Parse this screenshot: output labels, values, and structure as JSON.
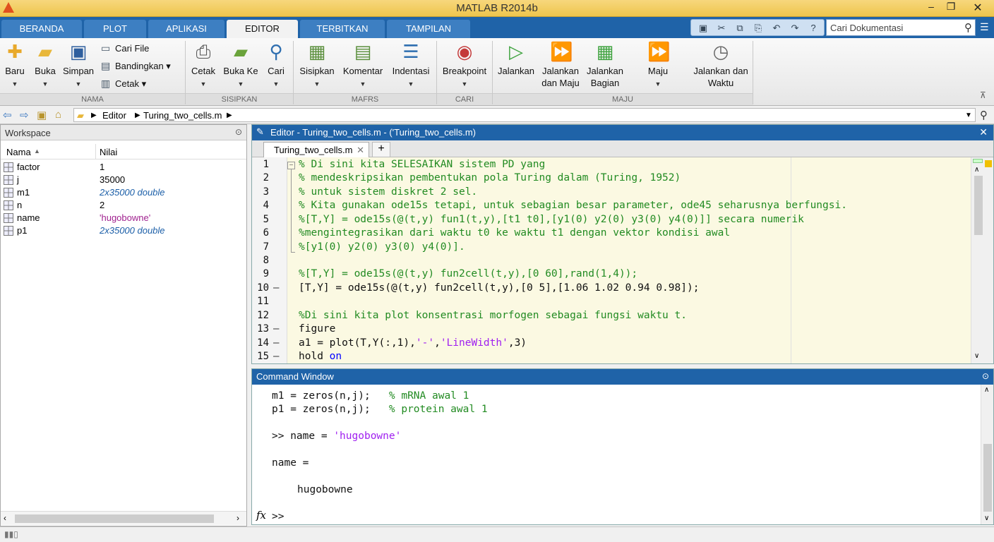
{
  "window": {
    "title": "MATLAB R2014b"
  },
  "tabs": [
    "BERANDA",
    "PLOT",
    "APLIKASI",
    "EDITOR",
    "TERBITKAN",
    "TAMPILAN"
  ],
  "search": {
    "placeholder": "Cari Dokumentasi"
  },
  "ribbon": {
    "file": {
      "new": "Baru",
      "open": "Buka",
      "save": "Simpan",
      "find_files": "Cari File",
      "compare": "Bandingkan",
      "print_small": "Cetak",
      "group": "NAMA"
    },
    "navigate": {
      "print": "Cetak",
      "goto": "Buka Ke",
      "find": "Cari",
      "group": "SISIPKAN"
    },
    "edit": {
      "insert": "Sisipkan",
      "comment": "Komentar",
      "indent": "Indentasi",
      "group": "MAFRS"
    },
    "breakpoints": {
      "label": "Breakpoint",
      "group": "CARI"
    },
    "run": {
      "run": "Jalankan",
      "run_advance": "Jalankan dan Maju",
      "run_section": "Jalankan Bagian",
      "advance": "Maju",
      "run_time": "Jalankan dan Waktu",
      "group": "MAJU"
    }
  },
  "breadcrumb": {
    "segment1": "Editor",
    "segment2": "Turing_two_cells.m"
  },
  "workspace": {
    "title": "Workspace",
    "col_name": "Nama",
    "col_value": "Nilai",
    "rows": [
      {
        "name": "factor",
        "value": "1"
      },
      {
        "name": "j",
        "value": "35000"
      },
      {
        "name": "m1",
        "value": "2x35000 double"
      },
      {
        "name": "n",
        "value": "2"
      },
      {
        "name": "name",
        "value": "'hugobowne'"
      },
      {
        "name": "p1",
        "value": "2x35000 double"
      }
    ]
  },
  "editor": {
    "title": "Editor - Turing_two_cells.m - ('Turing_two_cells.m)",
    "file_tab": "Turing_two_cells.m",
    "lines": [
      "% Di sini kita SELESAIKAN sistem PD yang",
      "% mendeskripsikan pembentukan pola Turing dalam (Turing, 1952)",
      "% untuk sistem diskret 2 sel.",
      "% Kita gunakan ode15s tetapi, untuk sebagian besar parameter, ode45 seharusnya berfungsi.",
      "%[T,Y] = ode15s(@(t,y) fun1(t,y),[t1 t0],[y1(0) y2(0) y3(0) y4(0)]] secara numerik",
      "%mengintegrasikan dari waktu t0 ke waktu t1 dengan vektor kondisi awal",
      "%[y1(0) y2(0) y3(0) y4(0)].",
      "",
      "%[T,Y] = ode15s(@(t,y) fun2cell(t,y),[0 60],rand(1,4));",
      "[T,Y] = ode15s(@(t,y) fun2cell(t,y),[0 5],[1.06 1.02 0.94 0.98]);",
      "",
      "%Di sini kita plot konsentrasi morfogen sebagai fungsi waktu t.",
      "figure",
      "a1 = plot(T,Y(:,1),'-','LineWidth',3)",
      "hold on"
    ]
  },
  "command": {
    "title": "Command Window",
    "line1_code": "m1 = zeros(n,j);   ",
    "line1_cmt": "% mRNA awal 1",
    "line2_code": "p1 = zeros(n,j);   ",
    "line2_cmt": "% protein awal 1",
    "line3_code": ">> name = ",
    "line3_str": "'hugobowne'",
    "line4": "name =",
    "line5": "hugobowne",
    "prompt": ">>",
    "fx": "fx"
  }
}
